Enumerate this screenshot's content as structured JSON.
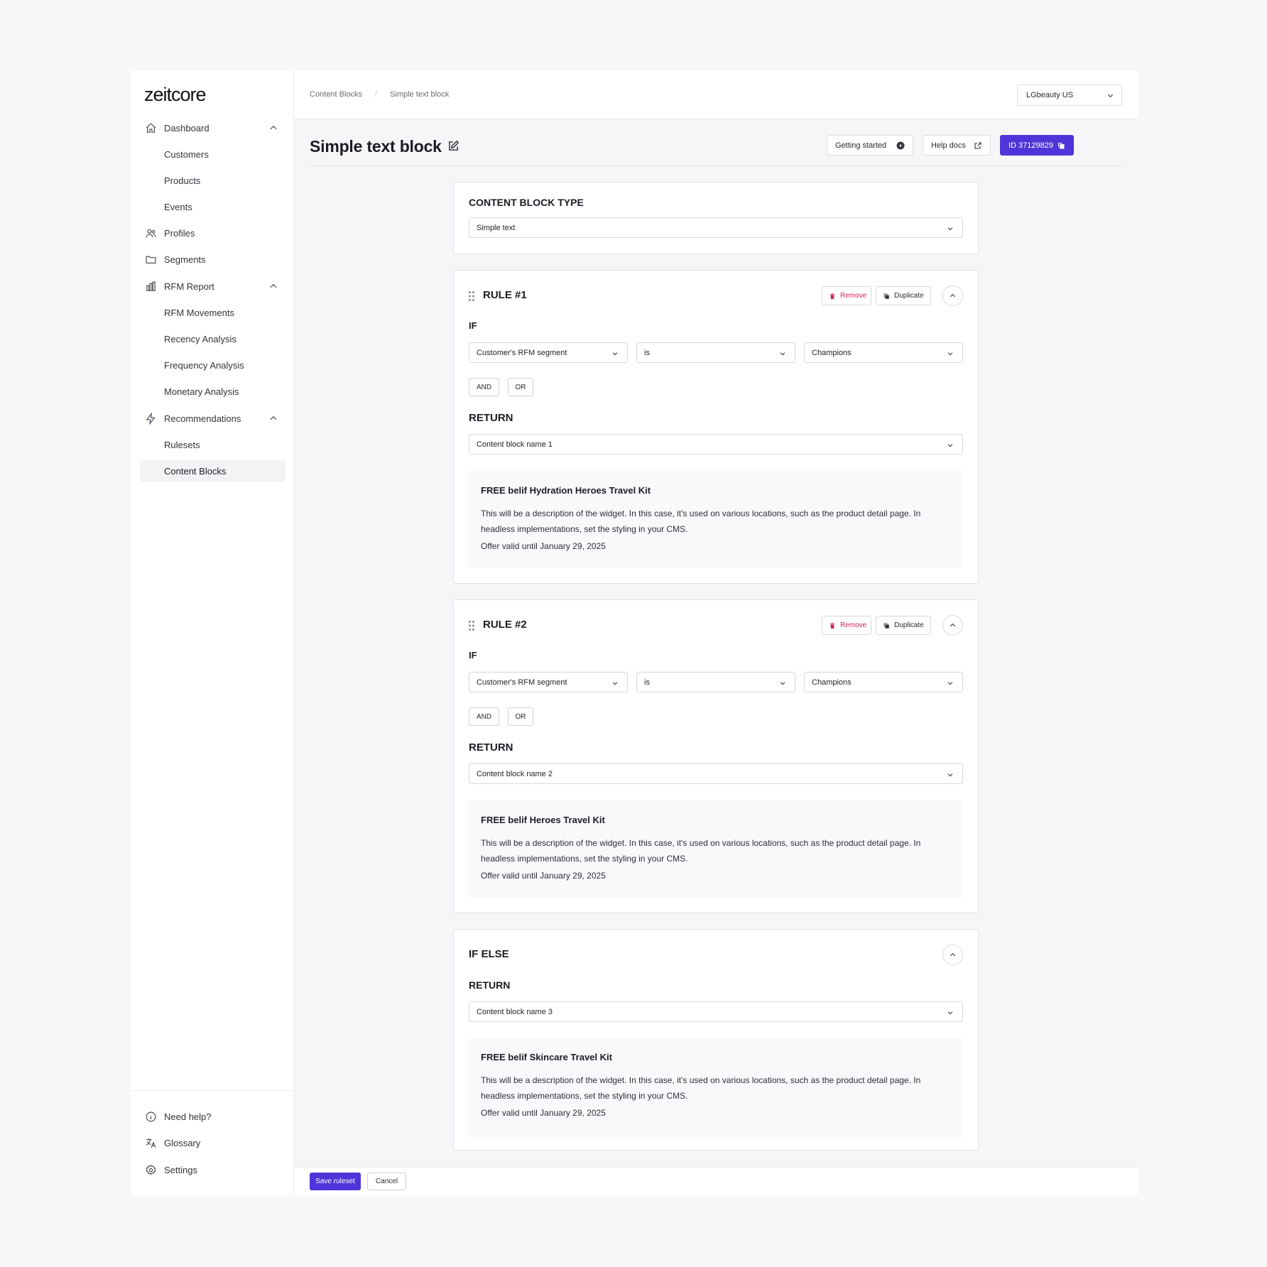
{
  "brand": {
    "logo": "zeitcore"
  },
  "sidebar": {
    "items": [
      {
        "label": "Dashboard",
        "icon": "home-icon"
      },
      {
        "label": "Customers"
      },
      {
        "label": "Products"
      },
      {
        "label": "Events"
      },
      {
        "label": "Profiles",
        "icon": "users-icon"
      },
      {
        "label": "Segments",
        "icon": "folder-icon"
      },
      {
        "label": "RFM Report",
        "icon": "bar-chart-icon"
      },
      {
        "label": "RFM Movements"
      },
      {
        "label": "Recency Analysis"
      },
      {
        "label": "Frequency Analysis"
      },
      {
        "label": "Monetary Analysis"
      },
      {
        "label": "Recommendations",
        "icon": "bolt-icon"
      },
      {
        "label": "Rulesets"
      },
      {
        "label": "Content Blocks",
        "active": true
      }
    ],
    "bottom": [
      {
        "label": "Need help?",
        "icon": "info-icon"
      },
      {
        "label": "Glossary",
        "icon": "translate-icon"
      },
      {
        "label": "Settings",
        "icon": "gear-icon"
      }
    ]
  },
  "topbar": {
    "breadcrumbs": [
      "Content Blocks",
      "/",
      "Simple text block"
    ],
    "store": "LGbeauty US"
  },
  "header": {
    "title": "Simple text block",
    "getting_started": "Getting started",
    "help_docs": "Help docs",
    "id_label": "ID 37129829"
  },
  "type_card": {
    "title": "CONTENT BLOCK TYPE",
    "value": "Simple text"
  },
  "rules": [
    {
      "title": "RULE #1",
      "remove": "Remove",
      "duplicate": "Duplicate",
      "if_label": "IF",
      "field": "Customer's RFM segment",
      "operator": "is",
      "value": "Champions",
      "and": "AND",
      "or": "OR",
      "return_label": "RETURN",
      "return_value": "Content block name 1",
      "preview": {
        "title": "FREE belif Hydration Heroes Travel Kit",
        "description": "This will be a description of the widget. In this case, it's used on various locations, such as the product detail page. In headless implementations, set the styling in your CMS.",
        "valid": "Offer valid until January 29, 2025"
      }
    },
    {
      "title": "RULE #2",
      "remove": "Remove",
      "duplicate": "Duplicate",
      "if_label": "IF",
      "field": "Customer's RFM segment",
      "operator": "is",
      "value": "Champions",
      "and": "AND",
      "or": "OR",
      "return_label": "RETURN",
      "return_value": "Content block name 2",
      "preview": {
        "title": "FREE belif Heroes Travel Kit",
        "description": "This will be a description of the widget. In this case, it's used on various locations, such as the product detail page. In headless implementations, set the styling in your CMS.",
        "valid": "Offer valid until January 29, 2025"
      }
    }
  ],
  "else_card": {
    "title": "IF ELSE",
    "return_label": "RETURN",
    "return_value": "Content block name 3",
    "preview": {
      "title": "FREE belif Skincare  Travel Kit",
      "description": "This will be a description of the widget. In this case, it's used on various locations, such as the product detail page. In headless implementations, set the styling in your CMS.",
      "valid": "Offer valid until January 29, 2025"
    }
  },
  "footer": {
    "save": "Save ruleset",
    "cancel": "Cancel"
  },
  "colors": {
    "accent": "#4f35d9",
    "danger": "#d0245a"
  }
}
